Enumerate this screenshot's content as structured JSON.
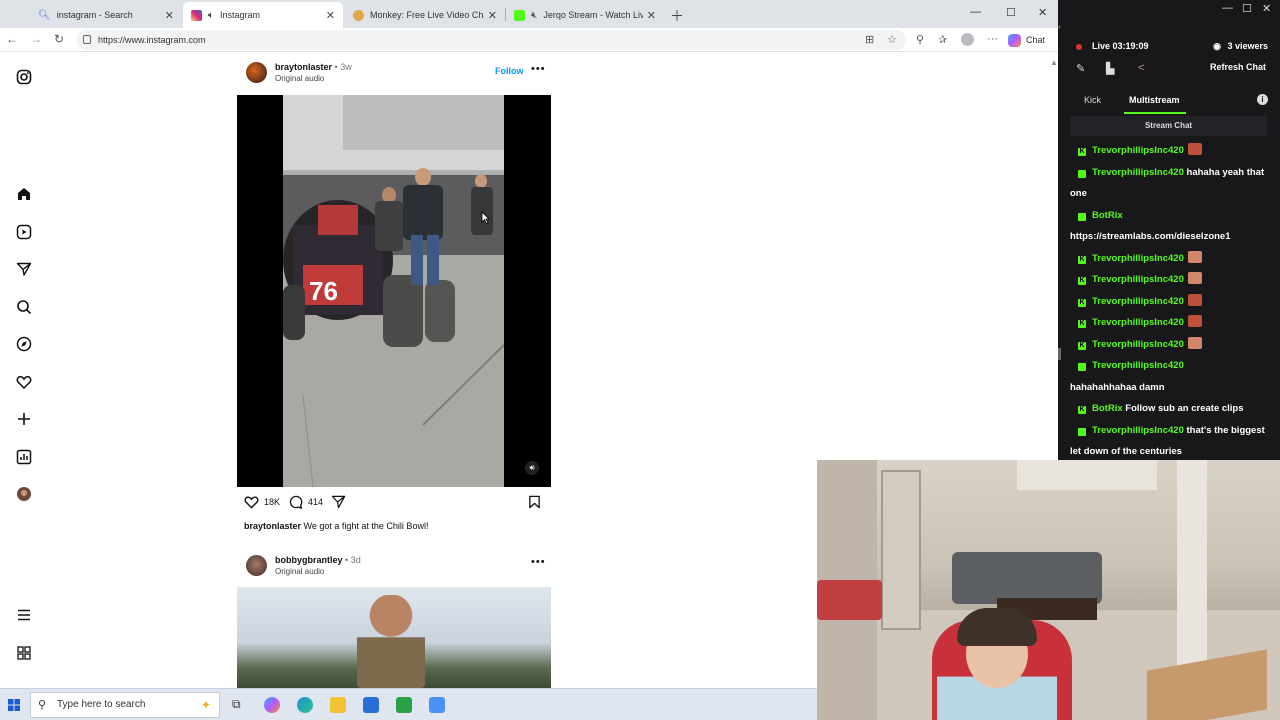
{
  "browser": {
    "tabs": [
      {
        "label": "instagram - Search",
        "color": "#4a6cf7"
      },
      {
        "label": "Instagram",
        "color": "#d6249f"
      },
      {
        "label": "Monkey: Free Live Video Chat to",
        "color": "#e0a84a"
      },
      {
        "label": "Jerqo Stream - Watch Live o",
        "color": "#53fc18"
      }
    ],
    "url": "https://www.instagram.com",
    "copilot_label": "Chat"
  },
  "instagram": {
    "posts": [
      {
        "username": "braytonlaster",
        "age": "3w",
        "sub": "Original audio",
        "follow": "Follow",
        "likes": "18K",
        "comments": "414",
        "caption_user": "braytonlaster",
        "caption_text": "We got a fight at the Chili Bowl!",
        "car_number": "76"
      },
      {
        "username": "bobbygbrantley",
        "age": "3d",
        "sub": "Original audio"
      }
    ],
    "sidebar_icons": [
      "instagram-logo-icon",
      "home-icon",
      "reels-icon",
      "messages-icon",
      "search-icon",
      "explore-icon",
      "heart-icon",
      "create-icon",
      "dashboard-icon",
      "profile-avatar",
      "menu-icon",
      "threads-icon"
    ]
  },
  "taskbar": {
    "search_placeholder": "Type here to search"
  },
  "chat_panel": {
    "live_label": "Live",
    "live_time": "03:19:09",
    "viewers": "3 viewers",
    "refresh": "Refresh Chat",
    "tabs": [
      "Kick",
      "Multistream"
    ],
    "active_tab": "Multistream",
    "section": "Stream Chat",
    "accent": "#53fc18",
    "messages": [
      {
        "user": "TrevorphillipsInc420",
        "text": "",
        "emote": "#c0503a"
      },
      {
        "user": "TrevorphillipsInc420",
        "text": "hahaha yeah that one",
        "emote": ""
      },
      {
        "user": "BotRix",
        "text": "https://streamlabs.com/dieselzone1",
        "emote": ""
      },
      {
        "user": "TrevorphillipsInc420",
        "text": "",
        "emote": "#d2866a"
      },
      {
        "user": "TrevorphillipsInc420",
        "text": "",
        "emote": "#d2866a"
      },
      {
        "user": "TrevorphillipsInc420",
        "text": "",
        "emote": "#c0503a"
      },
      {
        "user": "TrevorphillipsInc420",
        "text": "",
        "emote": "#c0503a"
      },
      {
        "user": "TrevorphillipsInc420",
        "text": "",
        "emote": "#d2866a"
      },
      {
        "user": "TrevorphillipsInc420",
        "text": "hahahahhahaa damn",
        "emote": ""
      },
      {
        "user": "BotRix",
        "text": "Follow sub an create clips",
        "emote": ""
      },
      {
        "user": "TrevorphillipsInc420",
        "text": "that's the biggest let down of the centuries",
        "emote": ""
      }
    ]
  }
}
